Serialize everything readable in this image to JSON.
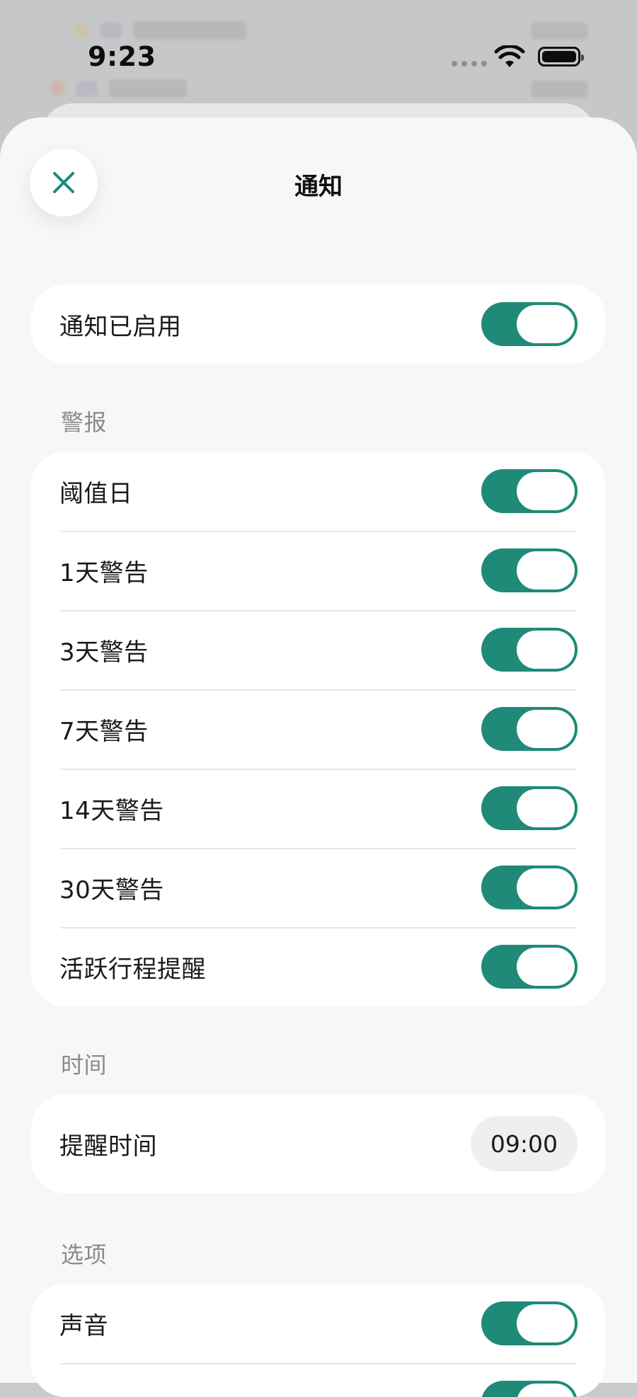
{
  "status_bar": {
    "time": "9:23"
  },
  "header": {
    "title": "通知"
  },
  "main_toggle": {
    "label": "通知已启用",
    "on": true
  },
  "sections": {
    "alerts": {
      "title": "警报",
      "items": [
        {
          "label": "阈值日",
          "on": true
        },
        {
          "label": "1天警告",
          "on": true
        },
        {
          "label": "3天警告",
          "on": true
        },
        {
          "label": "7天警告",
          "on": true
        },
        {
          "label": "14天警告",
          "on": true
        },
        {
          "label": "30天警告",
          "on": true
        },
        {
          "label": "活跃行程提醒",
          "on": true
        }
      ]
    },
    "time": {
      "title": "时间",
      "reminder_label": "提醒时间",
      "reminder_value": "09:00"
    },
    "options": {
      "title": "选项",
      "items": [
        {
          "label": "声音",
          "on": true
        }
      ]
    }
  },
  "colors": {
    "accent": "#1f8a78",
    "sheet_bg": "#f6f7f7",
    "card_bg": "#ffffff",
    "section_label": "#8a8b8b"
  },
  "icons": {
    "close": "close-icon",
    "wifi": "wifi-icon",
    "battery": "battery-icon"
  }
}
